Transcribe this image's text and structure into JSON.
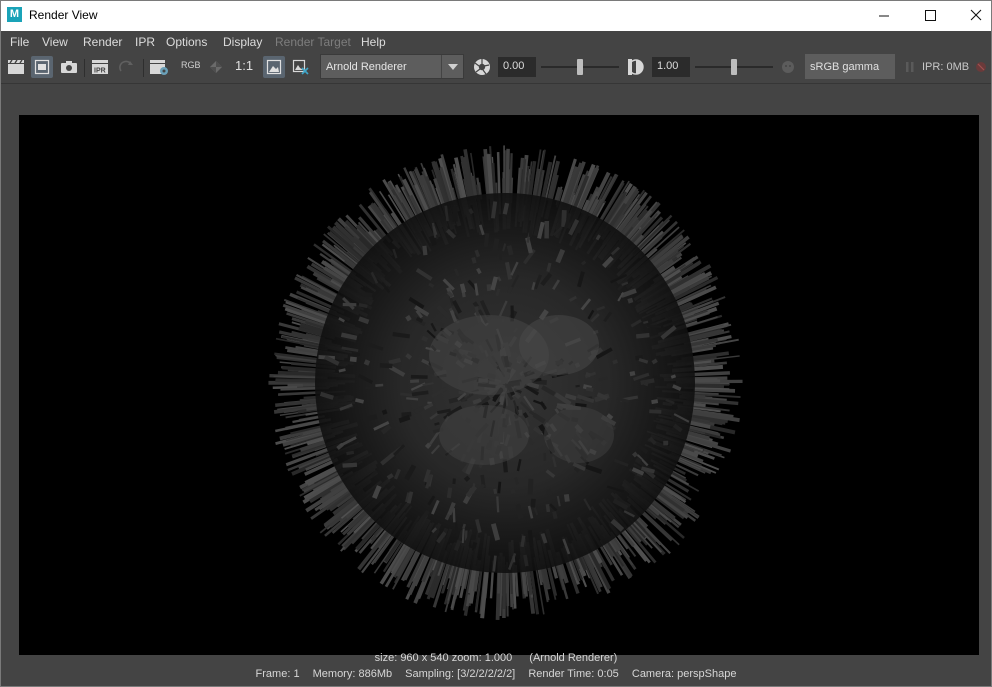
{
  "window": {
    "title": "Render View",
    "app_icon_letter": "M"
  },
  "menu": [
    {
      "label": "File",
      "enabled": true
    },
    {
      "label": "View",
      "enabled": true
    },
    {
      "label": "Render",
      "enabled": true
    },
    {
      "label": "IPR",
      "enabled": true
    },
    {
      "label": "Options",
      "enabled": true
    },
    {
      "label": "Display",
      "enabled": true
    },
    {
      "label": "Render Target",
      "enabled": false
    },
    {
      "label": "Help",
      "enabled": true
    }
  ],
  "toolbar": {
    "rgb_label": "RGB",
    "ratio_label": "1:1",
    "renderer": "Arnold Renderer",
    "exposure": "0.00",
    "exposure_level": 0.5,
    "gamma": "1.00",
    "gamma_level": 0.5,
    "color_space": "sRGB gamma",
    "ipr_memory": "IPR: 0MB"
  },
  "status": {
    "size": "size: 960 x 540 zoom: 1.000",
    "renderer": "(Arnold Renderer)",
    "frame": "Frame: 1",
    "memory": "Memory: 886Mb",
    "sampling": "Sampling: [3/2/2/2/2/2]",
    "render_time": "Render Time: 0:05",
    "camera": "Camera: perspShape"
  },
  "colors": {
    "accent": "#1aa3b8",
    "background": "#444444",
    "field": "#2b2b2b"
  }
}
